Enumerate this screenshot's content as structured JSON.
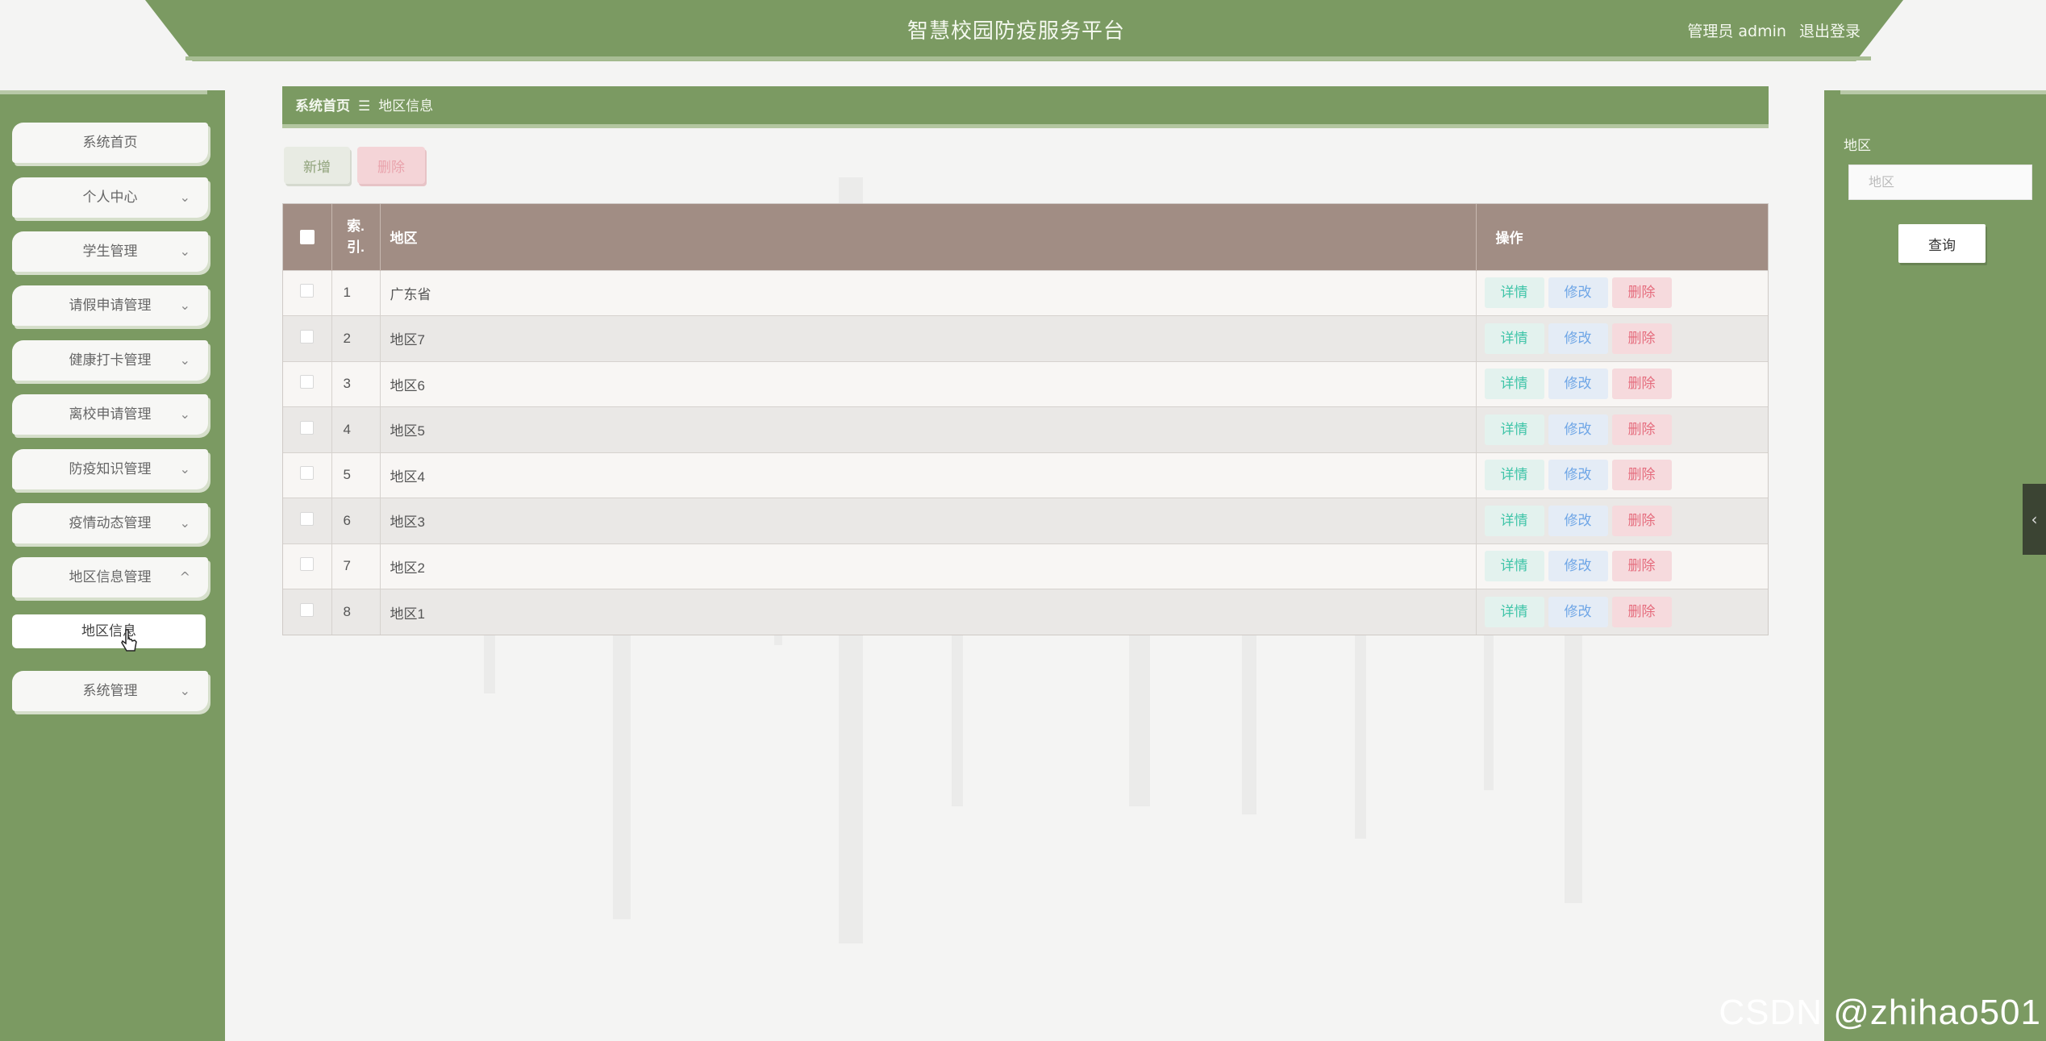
{
  "header": {
    "title": "智慧校园防疫服务平台",
    "role": "管理员",
    "username": "admin",
    "logout_label": "退出登录"
  },
  "sidebar": {
    "items": [
      {
        "label": "系统首页",
        "expandable": false
      },
      {
        "label": "个人中心",
        "expandable": true,
        "expanded": false
      },
      {
        "label": "学生管理",
        "expandable": true,
        "expanded": false
      },
      {
        "label": "请假申请管理",
        "expandable": true,
        "expanded": false
      },
      {
        "label": "健康打卡管理",
        "expandable": true,
        "expanded": false
      },
      {
        "label": "离校申请管理",
        "expandable": true,
        "expanded": false
      },
      {
        "label": "防疫知识管理",
        "expandable": true,
        "expanded": false
      },
      {
        "label": "疫情动态管理",
        "expandable": true,
        "expanded": false
      },
      {
        "label": "地区信息管理",
        "expandable": true,
        "expanded": true
      },
      {
        "label": "系统管理",
        "expandable": true,
        "expanded": false
      }
    ],
    "subitems": [
      {
        "label": "地区信息",
        "active": true
      }
    ],
    "chevron_down": "⌄",
    "chevron_up": "^"
  },
  "breadcrumb": {
    "home": "系统首页",
    "separator": "☰",
    "current": "地区信息"
  },
  "actions": {
    "add_label": "新增",
    "delete_label": "删除"
  },
  "table": {
    "headers": {
      "index": "索引",
      "region": "地区",
      "ops": "操作"
    },
    "op_labels": {
      "detail": "详情",
      "edit": "修改",
      "delete": "删除"
    },
    "rows": [
      {
        "index": "1",
        "region": "广东省"
      },
      {
        "index": "2",
        "region": "地区7"
      },
      {
        "index": "3",
        "region": "地区6"
      },
      {
        "index": "4",
        "region": "地区5"
      },
      {
        "index": "5",
        "region": "地区4"
      },
      {
        "index": "6",
        "region": "地区3"
      },
      {
        "index": "7",
        "region": "地区2"
      },
      {
        "index": "8",
        "region": "地区1"
      }
    ]
  },
  "search": {
    "label": "地区",
    "placeholder": "地区",
    "button_label": "查询"
  },
  "side_handle_icon": "‹",
  "watermark": "CSDN @zhihao501",
  "colors": {
    "primary_green": "#7b9a62",
    "table_header": "#a18d84",
    "detail": "#3fc4a8",
    "edit": "#6fa6e6",
    "delete": "#e56c7d"
  }
}
